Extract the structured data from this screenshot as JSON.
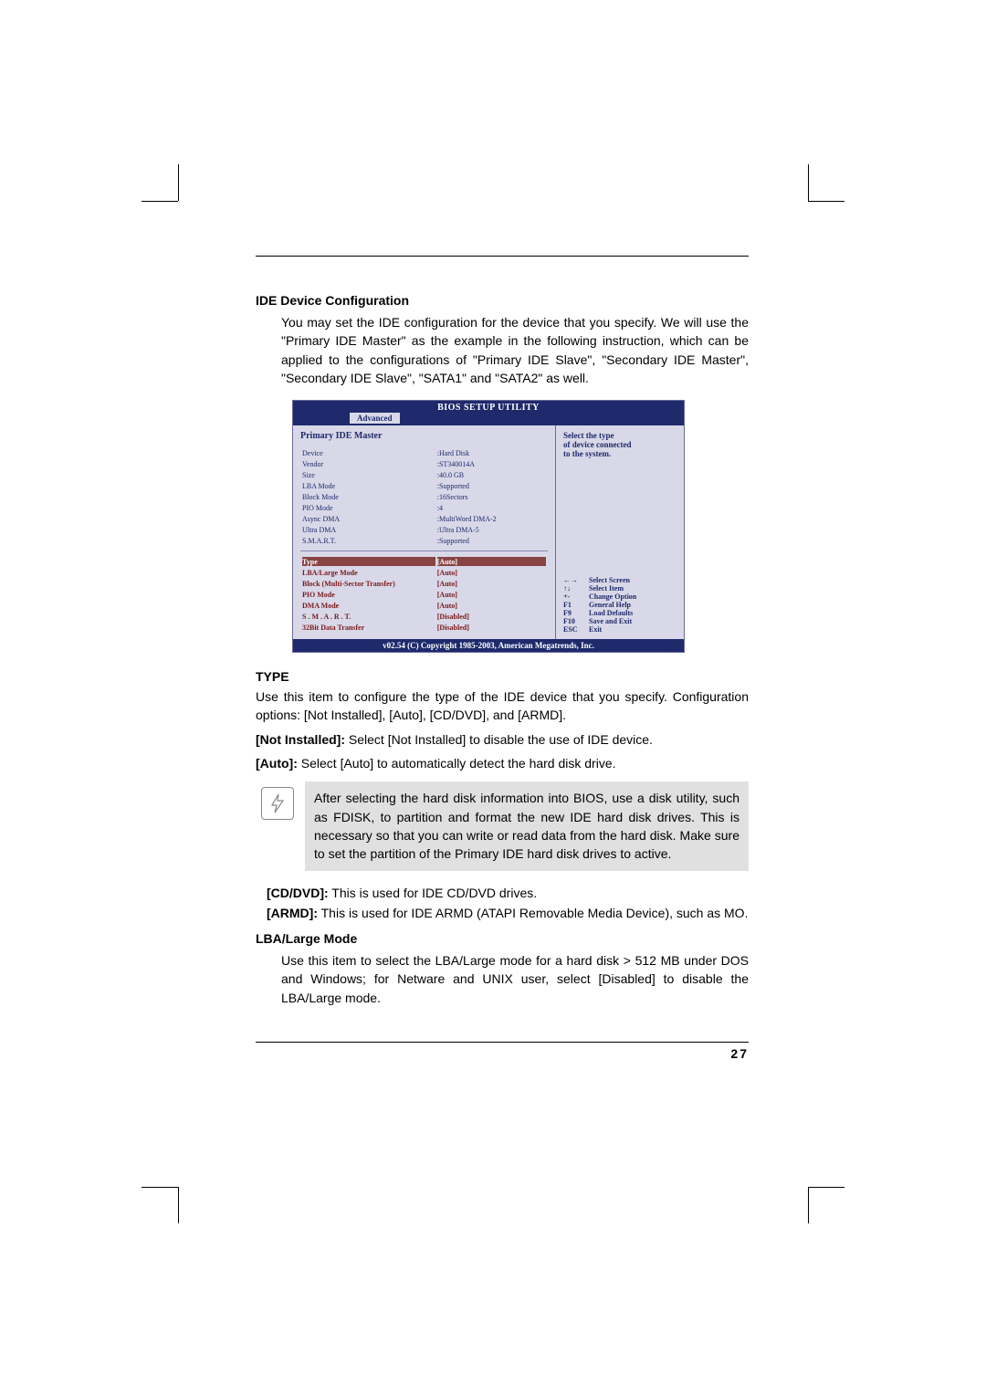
{
  "section_title": "IDE Device Configuration",
  "intro": "You may set the IDE configuration for the device that you specify. We will use the \"Primary IDE Master\" as the example in the following instruction, which can be applied to the configurations of \"Primary IDE Slave\", \"Secondary IDE Master\", \"Secondary IDE Slave\", \"SATA1\" and \"SATA2\" as well.",
  "bios": {
    "title": "BIOS SETUP UTILITY",
    "tab": "Advanced",
    "heading": "Primary IDE Master",
    "info": [
      {
        "k": "Device",
        "v": ":Hard Disk"
      },
      {
        "k": "Vendor",
        "v": ":ST340014A"
      },
      {
        "k": "Size",
        "v": ":40.0 GB"
      },
      {
        "k": "LBA Mode",
        "v": ":Supported"
      },
      {
        "k": "Block Mode",
        "v": ":16Sectors"
      },
      {
        "k": "PIO Mode",
        "v": ":4"
      },
      {
        "k": "Async DMA",
        "v": ":MultiWord DMA-2"
      },
      {
        "k": "Ultra DMA",
        "v": ":Ultra DMA-5"
      },
      {
        "k": "S.M.A.R.T.",
        "v": ":Supported"
      }
    ],
    "menu": [
      {
        "k": "Type",
        "v": "[Auto]",
        "selected": true
      },
      {
        "k": "LBA/Large Mode",
        "v": "[Auto]"
      },
      {
        "k": "Block (Multi-Sector Transfer)",
        "v": "[Auto]"
      },
      {
        "k": "PIO Mode",
        "v": "[Auto]"
      },
      {
        "k": "DMA Mode",
        "v": "[Auto]"
      },
      {
        "k": "S . M . A . R . T.",
        "v": "[Disabled]"
      },
      {
        "k": "32Bit Data Transfer",
        "v": "[Disabled]"
      }
    ],
    "help_top": [
      "Select the type",
      "of device connected",
      "to the system."
    ],
    "keys": [
      {
        "k": "←→",
        "d": "Select Screen"
      },
      {
        "k": "↑↓",
        "d": "Select Item"
      },
      {
        "k": "+-",
        "d": "Change Option"
      },
      {
        "k": "F1",
        "d": "General Help"
      },
      {
        "k": "F9",
        "d": "Load Defaults"
      },
      {
        "k": "F10",
        "d": "Save and Exit"
      },
      {
        "k": "ESC",
        "d": "Exit"
      }
    ],
    "footer": "v02.54 (C) Copyright 1985-2003, American Megatrends, Inc."
  },
  "type": {
    "title": "TYPE",
    "p1": "Use this item to configure the type of the IDE device that you specify. Configuration options: [Not Installed], [Auto], [CD/DVD], and [ARMD].",
    "not_installed_label": "[Not Installed]:",
    "not_installed_text": " Select [Not Installed] to disable the use of IDE device.",
    "auto_label": "[Auto]:",
    "auto_text": " Select [Auto] to automatically detect the hard disk drive."
  },
  "note": "After selecting the hard disk information into BIOS, use a disk utility, such as FDISK, to partition and format the new IDE hard disk drives. This is necessary so that you can write or read data from the hard disk. Make sure to set the partition of the Primary IDE hard disk drives to active.",
  "cddvd_label": "[CD/DVD]:",
  "cddvd_text": " This is used for IDE CD/DVD drives.",
  "armd_label": "[ARMD]:",
  "armd_text": "  This is used for IDE ARMD (ATAPI Removable Media Device), such as MO.",
  "lba": {
    "title": "LBA/Large Mode",
    "text": "Use this item to select the LBA/Large mode for a hard disk > 512 MB under DOS and Windows; for Netware and UNIX user, select [Disabled] to disable the LBA/Large mode."
  },
  "page_number": "27"
}
